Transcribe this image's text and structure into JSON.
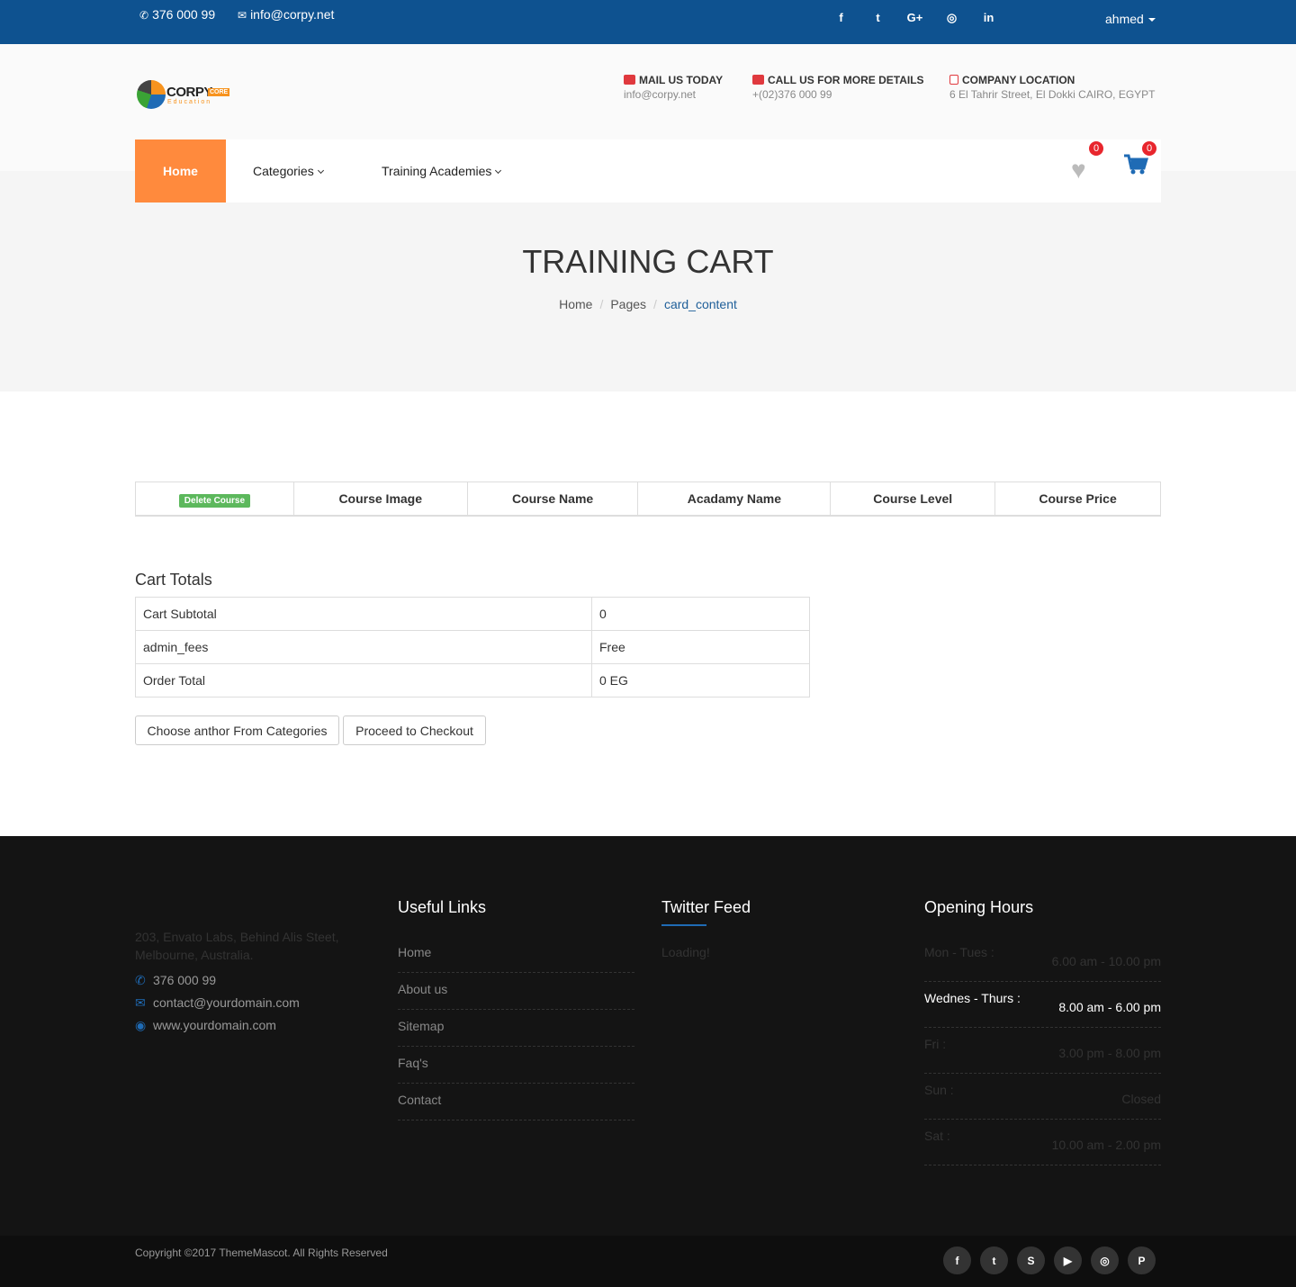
{
  "topbar": {
    "phone": "376 000 99",
    "email": "info@corpy.net",
    "socials": [
      {
        "icon": "facebook-icon",
        "glyph": "f"
      },
      {
        "icon": "twitter-icon",
        "glyph": "t"
      },
      {
        "icon": "google-plus-icon",
        "glyph": "G+"
      },
      {
        "icon": "instagram-icon",
        "glyph": "◎"
      },
      {
        "icon": "linkedin-icon",
        "glyph": "in"
      }
    ],
    "user": "ahmed"
  },
  "logo": {
    "word": "CORPY",
    "badge": "CORE",
    "sub": "Education"
  },
  "header_info": [
    {
      "title": "Mail Us Today",
      "sub": "info@corpy.net"
    },
    {
      "title": "Call us for more details",
      "sub": "+(02)376 000 99"
    },
    {
      "title": "Company Location",
      "sub": "6 El Tahrir Street, El Dokki CAIRO, EGYPT"
    }
  ],
  "nav": {
    "home": "Home",
    "categories": "Categories",
    "academies": "Training Academies",
    "wishlist_count": "0",
    "cart_count": "0"
  },
  "page": {
    "title": "TRAINING CART",
    "breadcrumb": [
      "Home",
      "Pages",
      "card_content"
    ]
  },
  "table": {
    "delete_label": "Delete Course",
    "headers": [
      "Course Image",
      "Course Name",
      "Acadamy Name",
      "Course Level",
      "Course Price"
    ]
  },
  "totals": {
    "title": "Cart Totals",
    "rows": [
      {
        "label": "Cart Subtotal",
        "value": "0"
      },
      {
        "label": "admin_fees",
        "value": "Free"
      },
      {
        "label": "Order Total",
        "value": "0 EG"
      }
    ],
    "btn_choose": "Choose anthor From Categories",
    "btn_checkout": "Proceed to Checkout"
  },
  "footer": {
    "address": "203, Envato Labs, Behind Alis Steet, Melbourne, Australia.",
    "phone": "376 000 99",
    "email": "contact@yourdomain.com",
    "website": "www.yourdomain.com",
    "useful_title": "Useful Links",
    "links": [
      "Home",
      "About us",
      "Sitemap",
      "Faq's",
      "Contact"
    ],
    "twitter_title": "Twitter Feed",
    "twitter_loading": "Loading!",
    "hours_title": "Opening Hours",
    "hours": [
      {
        "day": "Mon - Tues :",
        "time": "6.00 am - 10.00 pm"
      },
      {
        "day": "Wednes - Thurs :",
        "time": "8.00 am - 6.00 pm"
      },
      {
        "day": "Fri :",
        "time": "3.00 pm - 8.00 pm"
      },
      {
        "day": "Sun :",
        "time": "Closed"
      },
      {
        "day": "Sat :",
        "time": "10.00 am - 2.00 pm"
      }
    ],
    "copyright": "Copyright ©2017 ThemeMascot. All Rights Reserved",
    "socials": [
      {
        "icon": "facebook-icon",
        "glyph": "f"
      },
      {
        "icon": "twitter-icon",
        "glyph": "t"
      },
      {
        "icon": "skype-icon",
        "glyph": "S"
      },
      {
        "icon": "youtube-icon",
        "glyph": "▶"
      },
      {
        "icon": "instagram-icon",
        "glyph": "◎"
      },
      {
        "icon": "pinterest-icon",
        "glyph": "P"
      }
    ]
  }
}
